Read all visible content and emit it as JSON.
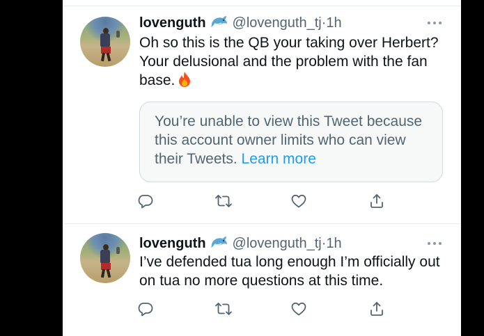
{
  "colors": {
    "text_primary": "#0f1419",
    "text_secondary": "#536471",
    "link": "#1d9bf0",
    "quote_background": "#f7f9f9",
    "quote_border": "#cfd9de"
  },
  "tweets": [
    {
      "display_name": "lovenguth",
      "badge_icon": "dolphin-emoji",
      "handle": "@lovenguth_tj",
      "separator": "·",
      "time": "1h",
      "more_icon": "more-dots-icon",
      "text": "Oh so this is the QB your taking over Herbert? Your delusional and the problem with the fan base.",
      "emoji_icon": "fire-emoji",
      "quote": {
        "message": "You’re unable to view this Tweet because this account owner limits who can view their Tweets.",
        "link": "Learn more"
      },
      "actions": [
        "reply-icon",
        "retweet-icon",
        "like-icon",
        "share-icon"
      ]
    },
    {
      "display_name": "lovenguth",
      "badge_icon": "dolphin-emoji",
      "handle": "@lovenguth_tj",
      "separator": "·",
      "time": "1h",
      "more_icon": "more-dots-icon",
      "text": "I’ve defended tua long enough I’m officially out on tua no more questions at this time.",
      "actions": [
        "reply-icon",
        "retweet-icon",
        "like-icon",
        "share-icon"
      ]
    }
  ]
}
